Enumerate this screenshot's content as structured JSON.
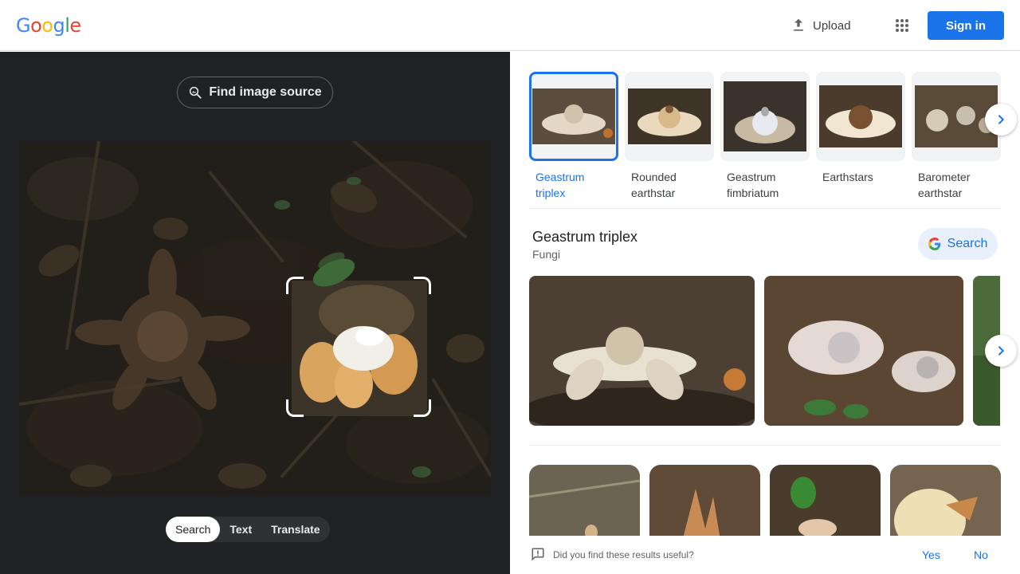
{
  "header": {
    "logo_letters": [
      {
        "ch": "G",
        "color": "#4285F4"
      },
      {
        "ch": "o",
        "color": "#EA4335"
      },
      {
        "ch": "o",
        "color": "#FBBC05"
      },
      {
        "ch": "g",
        "color": "#4285F4"
      },
      {
        "ch": "l",
        "color": "#34A853"
      },
      {
        "ch": "e",
        "color": "#EA4335"
      }
    ],
    "upload_label": "Upload",
    "apps_icon": "apps-grid-icon",
    "signin_label": "Sign in"
  },
  "left_panel": {
    "find_source_label": "Find image source",
    "modes": [
      {
        "label": "Search",
        "active": true
      },
      {
        "label": "Text",
        "active": false
      },
      {
        "label": "Translate",
        "active": false
      }
    ]
  },
  "related": {
    "items": [
      {
        "label_line1": "Geastrum",
        "label_line2": "triplex",
        "selected": true
      },
      {
        "label_line1": "Rounded",
        "label_line2": "earthstar",
        "selected": false
      },
      {
        "label_line1": "Geastrum",
        "label_line2": "fimbriatum",
        "selected": false
      },
      {
        "label_line1": "Earthstars",
        "label_line2": "",
        "selected": false
      },
      {
        "label_line1": "Barometer",
        "label_line2": "earthstar",
        "selected": false
      }
    ]
  },
  "entity": {
    "title": "Geastrum triplex",
    "subtitle": "Fungi",
    "search_label": "Search"
  },
  "feedback": {
    "question": "Did you find these results useful?",
    "yes_label": "Yes",
    "no_label": "No"
  },
  "colors": {
    "accent": "#1a73e8",
    "dark_panel": "#202124"
  }
}
